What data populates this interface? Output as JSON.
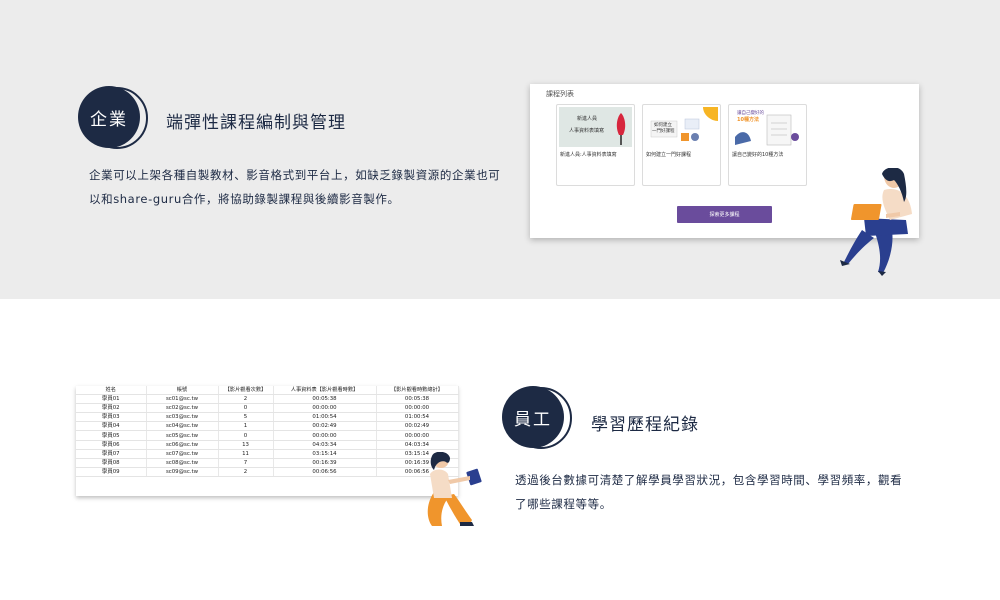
{
  "enterprise": {
    "badge": "企業",
    "heading": "端彈性課程編制與管理",
    "paragraph_lines": [
      "企業可以上架各種自製教材、影音格式到平台上，如缺乏錄製資源的企業也可",
      "以和share-guru合作，將協助錄製課程與後續影音製作。"
    ]
  },
  "course_panel": {
    "title": "課程列表",
    "courses": [
      {
        "title": "新進人員:人事資料表填寫",
        "thumb_text": [
          "新進人員",
          "人事資料表填寫"
        ]
      },
      {
        "title": "如何建立一門好課程",
        "thumb_text": [
          "如何建立",
          "一門好課程"
        ]
      },
      {
        "title": "讓自己變好的10種方法",
        "thumb_text": [
          "讓自己變好的",
          "10種方法"
        ]
      }
    ],
    "more_button": "探索更多課程"
  },
  "employee": {
    "badge": "員工",
    "heading": "學習歷程紀錄",
    "paragraph_lines": [
      "透過後台數據可清楚了解學員學習狀況，包含學習時間、學習頻率，觀看",
      "了哪些課程等等。"
    ]
  },
  "report_table": {
    "headers": [
      "姓名",
      "帳號",
      "【影片觀看次數】",
      "人事資料表【影片觀看時數】",
      "【影片觀看時數總計】"
    ],
    "rows": [
      [
        "學員01",
        "sc01@sc.tw",
        "2",
        "00:05:38",
        "00:05:38"
      ],
      [
        "學員02",
        "sc02@sc.tw",
        "0",
        "00:00:00",
        "00:00:00"
      ],
      [
        "學員03",
        "sc03@sc.tw",
        "5",
        "01:00:54",
        "01:00:54"
      ],
      [
        "學員04",
        "sc04@sc.tw",
        "1",
        "00:02:49",
        "00:02:49"
      ],
      [
        "學員05",
        "sc05@sc.tw",
        "0",
        "00:00:00",
        "00:00:00"
      ],
      [
        "學員06",
        "sc06@sc.tw",
        "13",
        "04:03:34",
        "04:03:34"
      ],
      [
        "學員07",
        "sc07@sc.tw",
        "11",
        "03:15:14",
        "03:15:14"
      ],
      [
        "學員08",
        "sc08@sc.tw",
        "7",
        "00:16:39",
        "00:16:39"
      ],
      [
        "學員09",
        "sc09@sc.tw",
        "2",
        "00:06:56",
        "00:06:56"
      ]
    ]
  },
  "colors": {
    "navy": "#1d2a44",
    "gray_band": "#ececec",
    "purple_button": "#6a4c9c",
    "orange": "#f0952c",
    "yellow": "#f7b524"
  }
}
